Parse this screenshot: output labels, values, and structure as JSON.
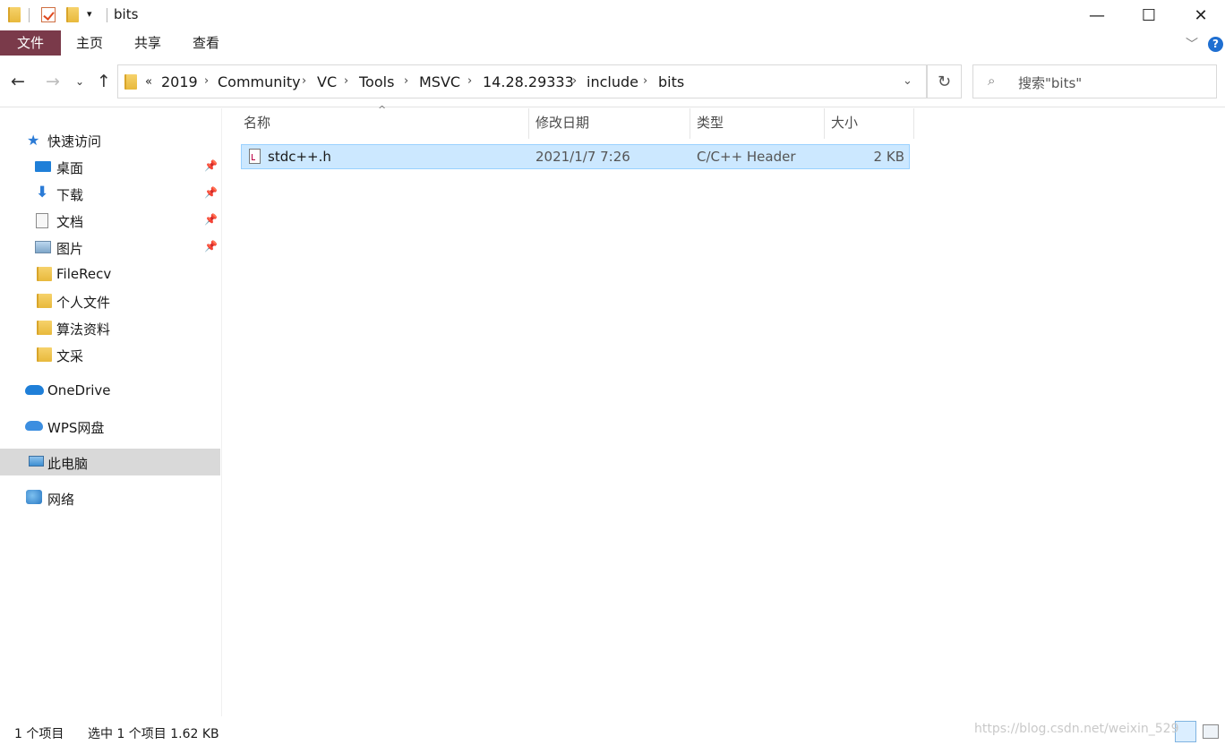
{
  "window": {
    "title": "bits",
    "controls": {
      "minimize": "—",
      "maximize": "☐",
      "close": "✕"
    }
  },
  "ribbon": {
    "tabs": [
      "文件",
      "主页",
      "共享",
      "查看"
    ]
  },
  "address": {
    "crumbs": [
      "2019",
      "Community",
      "VC",
      "Tools",
      "MSVC",
      "14.28.29333",
      "include",
      "bits"
    ],
    "overflow": "«"
  },
  "search": {
    "placeholder": "搜索\"bits\""
  },
  "sidebar": {
    "quick_access": "快速访问",
    "items": [
      {
        "label": "桌面",
        "pinned": true
      },
      {
        "label": "下载",
        "pinned": true
      },
      {
        "label": "文档",
        "pinned": true
      },
      {
        "label": "图片",
        "pinned": true
      },
      {
        "label": "FileRecv",
        "pinned": false
      },
      {
        "label": "个人文件",
        "pinned": false
      },
      {
        "label": "算法资料",
        "pinned": false
      },
      {
        "label": "文采",
        "pinned": false
      }
    ],
    "onedrive": "OneDrive",
    "wps": "WPS网盘",
    "this_pc": "此电脑",
    "network": "网络"
  },
  "columns": {
    "name": "名称",
    "modified": "修改日期",
    "type": "类型",
    "size": "大小"
  },
  "files": [
    {
      "name": "stdc++.h",
      "modified": "2021/1/7 7:26",
      "type": "C/C++ Header",
      "size": "2 KB"
    }
  ],
  "status": {
    "count": "1 个项目",
    "selected": "选中 1 个项目  1.62 KB"
  },
  "watermark": "https://blog.csdn.net/weixin_529"
}
